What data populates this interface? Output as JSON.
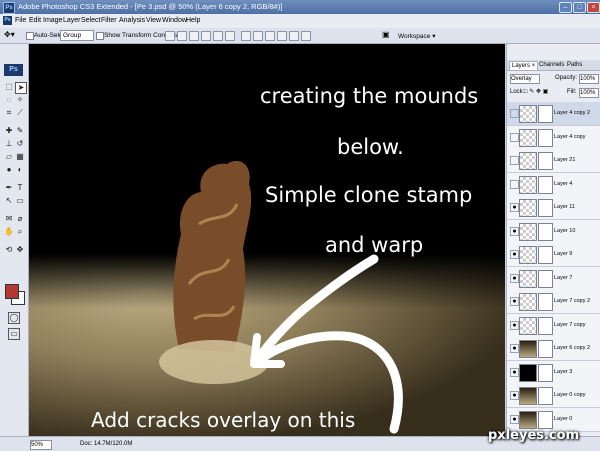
{
  "window": {
    "title": "Adobe Photoshop CS3 Extended - [Pe 3.psd @ 50% (Layer 6 copy 2, RGB/8#)]"
  },
  "menu": [
    "File",
    "Edit",
    "Image",
    "Layer",
    "Select",
    "Filter",
    "Analysis",
    "View",
    "Window",
    "Help"
  ],
  "options": {
    "auto_select_label": "Auto-Select:",
    "auto_select_value": "Group",
    "show_transform_label": "Show Transform Controls",
    "workspace_label": "Workspace ▾"
  },
  "toolbox": {
    "logo": "Ps",
    "fg_color": "#b23a35",
    "bg_color": "#ffffff"
  },
  "canvas": {
    "annotation_lines": [
      "creating the mounds",
      "below.",
      "Simple clone stamp",
      "and warp"
    ],
    "bottom_caption": "Add cracks overlay on this"
  },
  "layers_panel": {
    "tabs": [
      "Layers ×",
      "Channels",
      "Paths"
    ],
    "blend_mode": "Overlay",
    "opacity_label": "Opacity:",
    "opacity_value": "100%",
    "lock_label": "Lock:",
    "fill_label": "Fill:",
    "fill_value": "100%",
    "layers": [
      {
        "name": "Layer 4 copy 2",
        "visible": false,
        "thumb": "checker"
      },
      {
        "name": "Layer 4 copy",
        "visible": false,
        "thumb": "checker"
      },
      {
        "name": "Layer 21",
        "visible": false,
        "thumb": "checker"
      },
      {
        "name": "Layer 4",
        "visible": false,
        "thumb": "checker"
      },
      {
        "name": "Layer 11",
        "visible": true,
        "thumb": "checker"
      },
      {
        "name": "Layer 10",
        "visible": true,
        "thumb": "checker"
      },
      {
        "name": "Layer 9",
        "visible": true,
        "thumb": "checker"
      },
      {
        "name": "Layer 7",
        "visible": true,
        "thumb": "checker"
      },
      {
        "name": "Layer 7 copy 2",
        "visible": true,
        "thumb": "checker"
      },
      {
        "name": "Layer 7 copy",
        "visible": true,
        "thumb": "checker"
      },
      {
        "name": "Layer 6 copy 2",
        "visible": true,
        "thumb": "sand"
      },
      {
        "name": "Layer 3",
        "visible": true,
        "thumb": "black"
      },
      {
        "name": "Layer 0 copy",
        "visible": true,
        "thumb": "sand"
      },
      {
        "name": "Layer 0",
        "visible": true,
        "thumb": "sand"
      }
    ]
  },
  "status": {
    "zoom": "50%",
    "doc": "Doc: 14.7M/120.0M"
  },
  "watermark": "pxleyes.com"
}
